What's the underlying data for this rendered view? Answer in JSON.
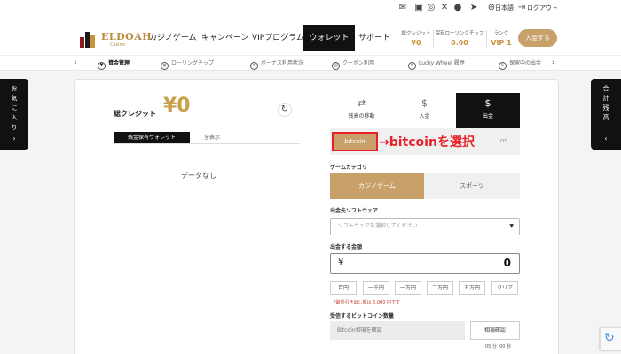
{
  "topbar": {
    "icons": [
      "message-icon",
      "gift-icon",
      "instagram-icon",
      "x-icon",
      "line-icon",
      "telegram-icon"
    ],
    "language": "日本語",
    "logout": "ログアウト"
  },
  "header": {
    "logo_name": "ELDOAH",
    "logo_sub": "Casino",
    "nav": [
      {
        "label": "カジノゲーム"
      },
      {
        "label": "キャンペーン"
      },
      {
        "label": "VIPプログラム"
      },
      {
        "label": "ウォレット"
      },
      {
        "label": "サポート"
      }
    ],
    "balances": [
      {
        "label": "総クレジット",
        "value": "¥0"
      },
      {
        "label": "保有ローリングチップ",
        "value": "0.00"
      },
      {
        "label": "ランク",
        "value": "VIP 1"
      }
    ],
    "deposit": "入金する"
  },
  "subnav": {
    "items": [
      {
        "label": "資金管理",
        "icon": "¥"
      },
      {
        "label": "ローリングチップ",
        "icon": "◉"
      },
      {
        "label": "ボーナス利用状況",
        "icon": "★"
      },
      {
        "label": "クーポン利用",
        "icon": "▤"
      },
      {
        "label": "Lucky Wheel 履歴",
        "icon": "✲"
      },
      {
        "label": "保留中の出金",
        "icon": "$"
      }
    ]
  },
  "side": {
    "left": "お気に入り",
    "right": "合計残高"
  },
  "wallet": {
    "credit_label": "総クレジット",
    "credit_value": "¥0",
    "tab_owned": "残金保有ウォレット",
    "tab_all": "全表示",
    "no_data": "データなし"
  },
  "ops": {
    "tabs": [
      {
        "label": "残高の移動",
        "icon": "⇄"
      },
      {
        "label": "入金",
        "icon": "$"
      },
      {
        "label": "出金",
        "icon": "$"
      }
    ],
    "method_btc": "bitcoin",
    "method_other": "on",
    "annotation": "bitcoinを選択",
    "game_category_label": "ゲームカテゴリ",
    "cat_casino": "カジノゲーム",
    "cat_sports": "スポーツ",
    "software_label": "出金先ソフトウェア",
    "software_placeholder": "ソフトウェアを選択してください",
    "amount_label": "出金する金額",
    "currency": "¥",
    "amount": "0",
    "quick": [
      "百円",
      "一千円",
      "一万円",
      "二万円",
      "五万円",
      "クリア"
    ],
    "min_note": "*最低引き出し額は 5,000 円です",
    "btc_label": "受信するビットコイン数量",
    "btc_placeholder": "Bitcoin相場を確認",
    "rate_button": "相場確認",
    "timer": "05 分 ,00 秒"
  }
}
